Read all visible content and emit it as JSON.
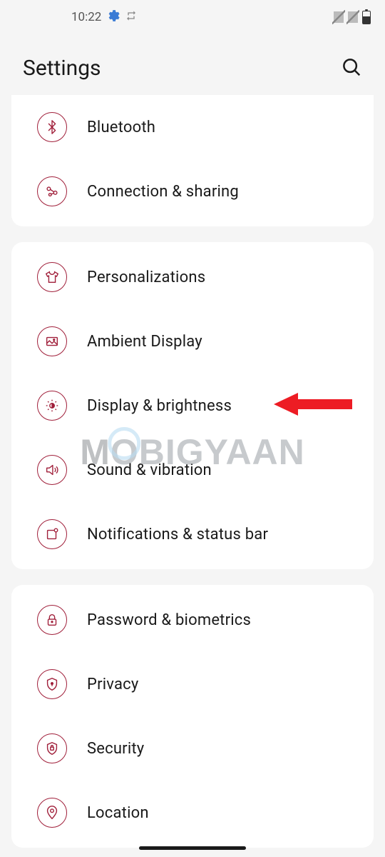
{
  "statusBar": {
    "time": "10:22"
  },
  "header": {
    "title": "Settings"
  },
  "groups": [
    {
      "items": [
        {
          "icon": "bluetooth",
          "label": "Bluetooth"
        },
        {
          "icon": "connection",
          "label": "Connection & sharing"
        }
      ]
    },
    {
      "items": [
        {
          "icon": "personalizations",
          "label": "Personalizations"
        },
        {
          "icon": "ambient",
          "label": "Ambient Display"
        },
        {
          "icon": "display",
          "label": "Display & brightness",
          "highlighted": true
        },
        {
          "icon": "sound",
          "label": "Sound & vibration"
        },
        {
          "icon": "notifications",
          "label": "Notifications & status bar"
        }
      ]
    },
    {
      "items": [
        {
          "icon": "password",
          "label": "Password & biometrics"
        },
        {
          "icon": "privacy",
          "label": "Privacy"
        },
        {
          "icon": "security",
          "label": "Security"
        },
        {
          "icon": "location",
          "label": "Location"
        }
      ]
    }
  ],
  "watermark": "MOBIGYAAN",
  "accentColor": "#a01f3a",
  "arrowColor": "#ed1c24"
}
